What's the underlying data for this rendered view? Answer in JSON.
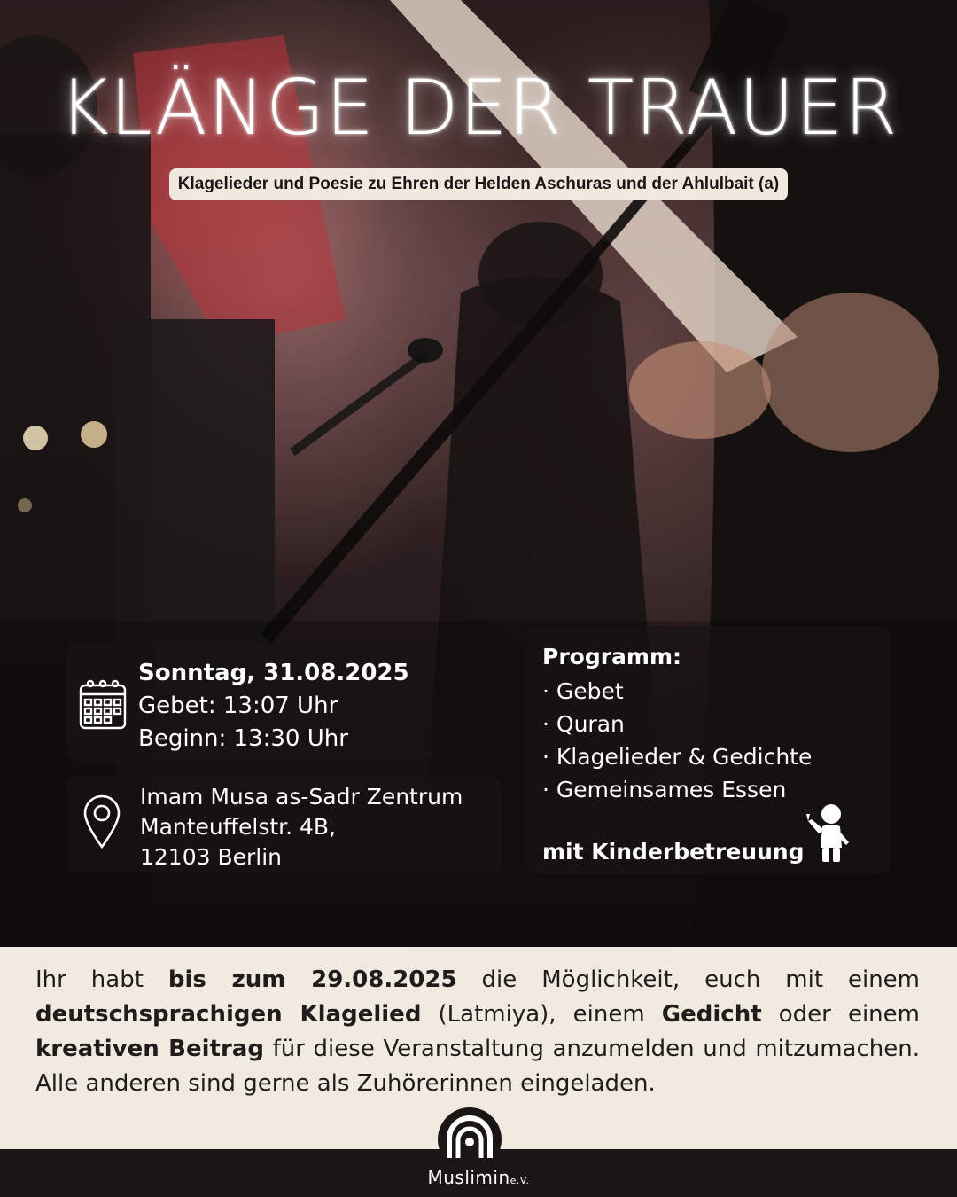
{
  "title": "KLÄNGE DER TRAUER",
  "subtitle": "Klagelieder und Poesie zu Ehren der Helden Aschuras und der Ahlulbait (a)",
  "event": {
    "date": "Sonntag, 31.08.2025",
    "prayer": "Gebet: 13:07 Uhr",
    "start": "Beginn: 13:30 Uhr"
  },
  "location": {
    "name": "Imam Musa as-Sadr Zentrum",
    "street": "Manteuffelstr. 4B,",
    "city": "12103 Berlin"
  },
  "program": {
    "heading": "Programm:",
    "items": [
      "Gebet",
      "Quran",
      "Klagelieder & Gedichte",
      "Gemeinsames Essen"
    ],
    "childcare": "mit Kinderbetreuung"
  },
  "info": {
    "t1": "Ihr habt ",
    "b1": "bis zum 29.08.2025",
    "t2": " die Möglichkeit, euch mit einem ",
    "b2": "deutschsprachigen Klagelied",
    "t3": " (Latmiya), einem ",
    "b3": "Gedicht",
    "t4": " oder einem ",
    "b4": "kreativen Beitrag",
    "t5": " für diese Veranstaltung anzumelden und mitzumachen. Alle anderen sind gerne als Zuhörerinnen eingeladen."
  },
  "brand": {
    "name": "Muslimin",
    "suffix": "e.V."
  },
  "icons": [
    "calendar-icon",
    "location-pin-icon",
    "child-icon",
    "muslimin-logo"
  ]
}
